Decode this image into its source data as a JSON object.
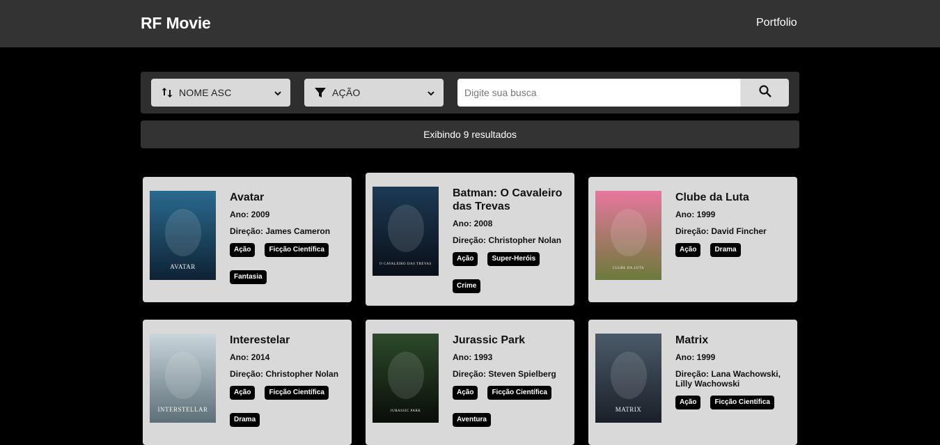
{
  "header": {
    "brand": "RF Movie",
    "nav_link": "Portfolio"
  },
  "filters": {
    "sort_label": "NOME ASC",
    "genre_label": "AÇÃO",
    "search_placeholder": "Digite sua busca",
    "search_value": ""
  },
  "results_text": "Exibindo 9 resultados",
  "movies": [
    {
      "title": "Avatar",
      "year": "Ano: 2009",
      "director": "Direção: James Cameron",
      "tags": [
        "Ação",
        "Ficção Científica",
        "Fantasia"
      ],
      "poster_text": "AVATAR",
      "poster_colors": [
        "#2a6a8f",
        "#0e2233"
      ]
    },
    {
      "title": "Batman: O Cavaleiro das Trevas",
      "year": "Ano: 2008",
      "director": "Direção: Christopher Nolan",
      "tags": [
        "Ação",
        "Super-Heróis",
        "Crime"
      ],
      "poster_text": "O CAVALEIRO DAS TREVAS",
      "poster_colors": [
        "#1d3a55",
        "#0a0f18"
      ]
    },
    {
      "title": "Clube da Luta",
      "year": "Ano: 1999",
      "director": "Direção: David Fincher",
      "tags": [
        "Ação",
        "Drama"
      ],
      "poster_text": "CLUBE DA LUTA",
      "poster_colors": [
        "#e8779e",
        "#6c7a3a"
      ]
    },
    {
      "title": "Interestelar",
      "year": "Ano: 2014",
      "director": "Direção: Christopher Nolan",
      "tags": [
        "Ação",
        "Ficção Científica",
        "Drama"
      ],
      "poster_text": "INTERSTELLAR",
      "poster_colors": [
        "#c9d6dc",
        "#5d6f78"
      ]
    },
    {
      "title": "Jurassic Park",
      "year": "Ano: 1993",
      "director": "Direção: Steven Spielberg",
      "tags": [
        "Ação",
        "Ficção Científica",
        "Aventura"
      ],
      "poster_text": "JURASSIC PARK",
      "poster_colors": [
        "#2c4a2a",
        "#0a0d08"
      ]
    },
    {
      "title": "Matrix",
      "year": "Ano: 1999",
      "director": "Direção: Lana Wachowski, Lilly Wachowski",
      "tags": [
        "Ação",
        "Ficção Científica"
      ],
      "poster_text": "MATRIX",
      "poster_colors": [
        "#4b5a6a",
        "#1a2028"
      ]
    }
  ]
}
